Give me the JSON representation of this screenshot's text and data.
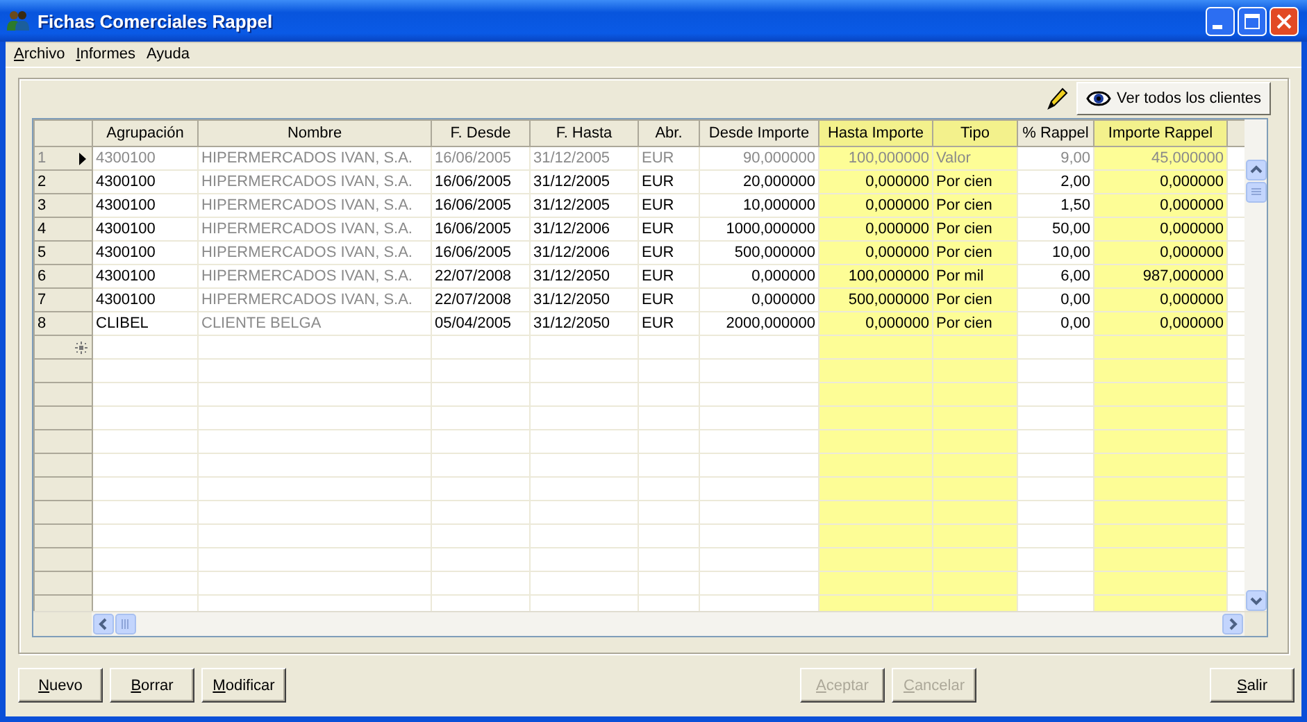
{
  "window": {
    "title": "Fichas Comerciales Rappel"
  },
  "menu": [
    {
      "label": "Archivo",
      "accelerator": true
    },
    {
      "label": "Informes",
      "accelerator": true
    },
    {
      "label": "Ayuda",
      "accelerator": false
    }
  ],
  "toolbar": {
    "button": "Ver todos los clientes"
  },
  "grid": {
    "columns": [
      {
        "label": "Agrupación",
        "kind": "text",
        "readonly": false,
        "highlighted": false
      },
      {
        "label": "Nombre",
        "kind": "text",
        "readonly": true,
        "highlighted": false
      },
      {
        "label": "F. Desde",
        "kind": "text",
        "readonly": false,
        "highlighted": false
      },
      {
        "label": "F. Hasta",
        "kind": "text",
        "readonly": false,
        "highlighted": false
      },
      {
        "label": "Abr.",
        "kind": "text",
        "readonly": false,
        "highlighted": false
      },
      {
        "label": "Desde Importe",
        "kind": "number",
        "readonly": false,
        "highlighted": false
      },
      {
        "label": "Hasta Importe",
        "kind": "number",
        "readonly": false,
        "highlighted": true
      },
      {
        "label": "Tipo",
        "kind": "text",
        "readonly": false,
        "highlighted": true
      },
      {
        "label": "% Rappel",
        "kind": "number",
        "readonly": false,
        "highlighted": false
      },
      {
        "label": "Importe Rappel",
        "kind": "number",
        "readonly": false,
        "highlighted": true
      }
    ],
    "rows": [
      {
        "number": "1",
        "selected": true,
        "cells": [
          "4300100",
          "HIPERMERCADOS IVAN, S.A.",
          "16/06/2005",
          "31/12/2005",
          "EUR",
          "90,000000",
          "100,000000",
          "Valor",
          "9,00",
          "45,000000"
        ]
      },
      {
        "number": "2",
        "selected": false,
        "cells": [
          "4300100",
          "HIPERMERCADOS IVAN, S.A.",
          "16/06/2005",
          "31/12/2005",
          "EUR",
          "20,000000",
          "0,000000",
          "Por cien",
          "2,00",
          "0,000000"
        ]
      },
      {
        "number": "3",
        "selected": false,
        "cells": [
          "4300100",
          "HIPERMERCADOS IVAN, S.A.",
          "16/06/2005",
          "31/12/2005",
          "EUR",
          "10,000000",
          "0,000000",
          "Por cien",
          "1,50",
          "0,000000"
        ]
      },
      {
        "number": "4",
        "selected": false,
        "cells": [
          "4300100",
          "HIPERMERCADOS IVAN, S.A.",
          "16/06/2005",
          "31/12/2006",
          "EUR",
          "1000,000000",
          "0,000000",
          "Por cien",
          "50,00",
          "0,000000"
        ]
      },
      {
        "number": "5",
        "selected": false,
        "cells": [
          "4300100",
          "HIPERMERCADOS IVAN, S.A.",
          "16/06/2005",
          "31/12/2006",
          "EUR",
          "500,000000",
          "0,000000",
          "Por cien",
          "10,00",
          "0,000000"
        ]
      },
      {
        "number": "6",
        "selected": false,
        "cells": [
          "4300100",
          "HIPERMERCADOS IVAN, S.A.",
          "22/07/2008",
          "31/12/2050",
          "EUR",
          "0,000000",
          "100,000000",
          "Por mil",
          "6,00",
          "987,000000"
        ]
      },
      {
        "number": "7",
        "selected": false,
        "cells": [
          "4300100",
          "HIPERMERCADOS IVAN, S.A.",
          "22/07/2008",
          "31/12/2050",
          "EUR",
          "0,000000",
          "500,000000",
          "Por cien",
          "0,00",
          "0,000000"
        ]
      },
      {
        "number": "8",
        "selected": false,
        "cells": [
          "CLIBEL",
          "CLIENTE BELGA",
          "05/04/2005",
          "31/12/2050",
          "EUR",
          "2000,000000",
          "0,000000",
          "Por cien",
          "0,00",
          "0,000000"
        ]
      }
    ]
  },
  "buttons": {
    "left": [
      {
        "label": "Nuevo",
        "disabled": false,
        "accelerator": true
      },
      {
        "label": "Borrar",
        "disabled": false,
        "accelerator": true
      },
      {
        "label": "Modificar",
        "disabled": false,
        "accelerator": true
      }
    ],
    "center": [
      {
        "label": "Aceptar",
        "disabled": true,
        "accelerator": true
      },
      {
        "label": "Cancelar",
        "disabled": true,
        "accelerator": true
      }
    ],
    "right": [
      {
        "label": "Salir",
        "disabled": false,
        "accelerator": true
      }
    ]
  }
}
